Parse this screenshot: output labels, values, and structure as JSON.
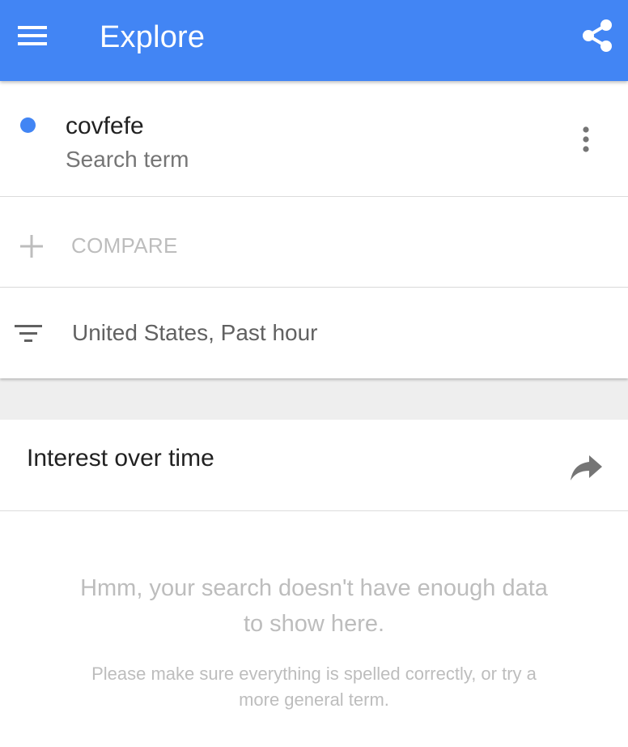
{
  "colors": {
    "brand": "#4285f4",
    "term_dot": "#4285f4"
  },
  "appbar": {
    "title": "Explore",
    "menu_icon": "hamburger-menu-icon",
    "share_icon": "share-icon"
  },
  "term": {
    "name": "covfefe",
    "type": "Search term",
    "more_icon": "more-vertical-icon"
  },
  "compare": {
    "label": "COMPARE",
    "icon": "plus-icon"
  },
  "filter": {
    "label": "United States, Past hour",
    "icon": "filter-icon"
  },
  "interest_card": {
    "title": "Interest over time",
    "share_icon": "share-arrow-icon",
    "empty_message": "Hmm, your search doesn't have enough data to show here.",
    "empty_hint": "Please make sure everything is spelled correctly, or try a more general term."
  }
}
